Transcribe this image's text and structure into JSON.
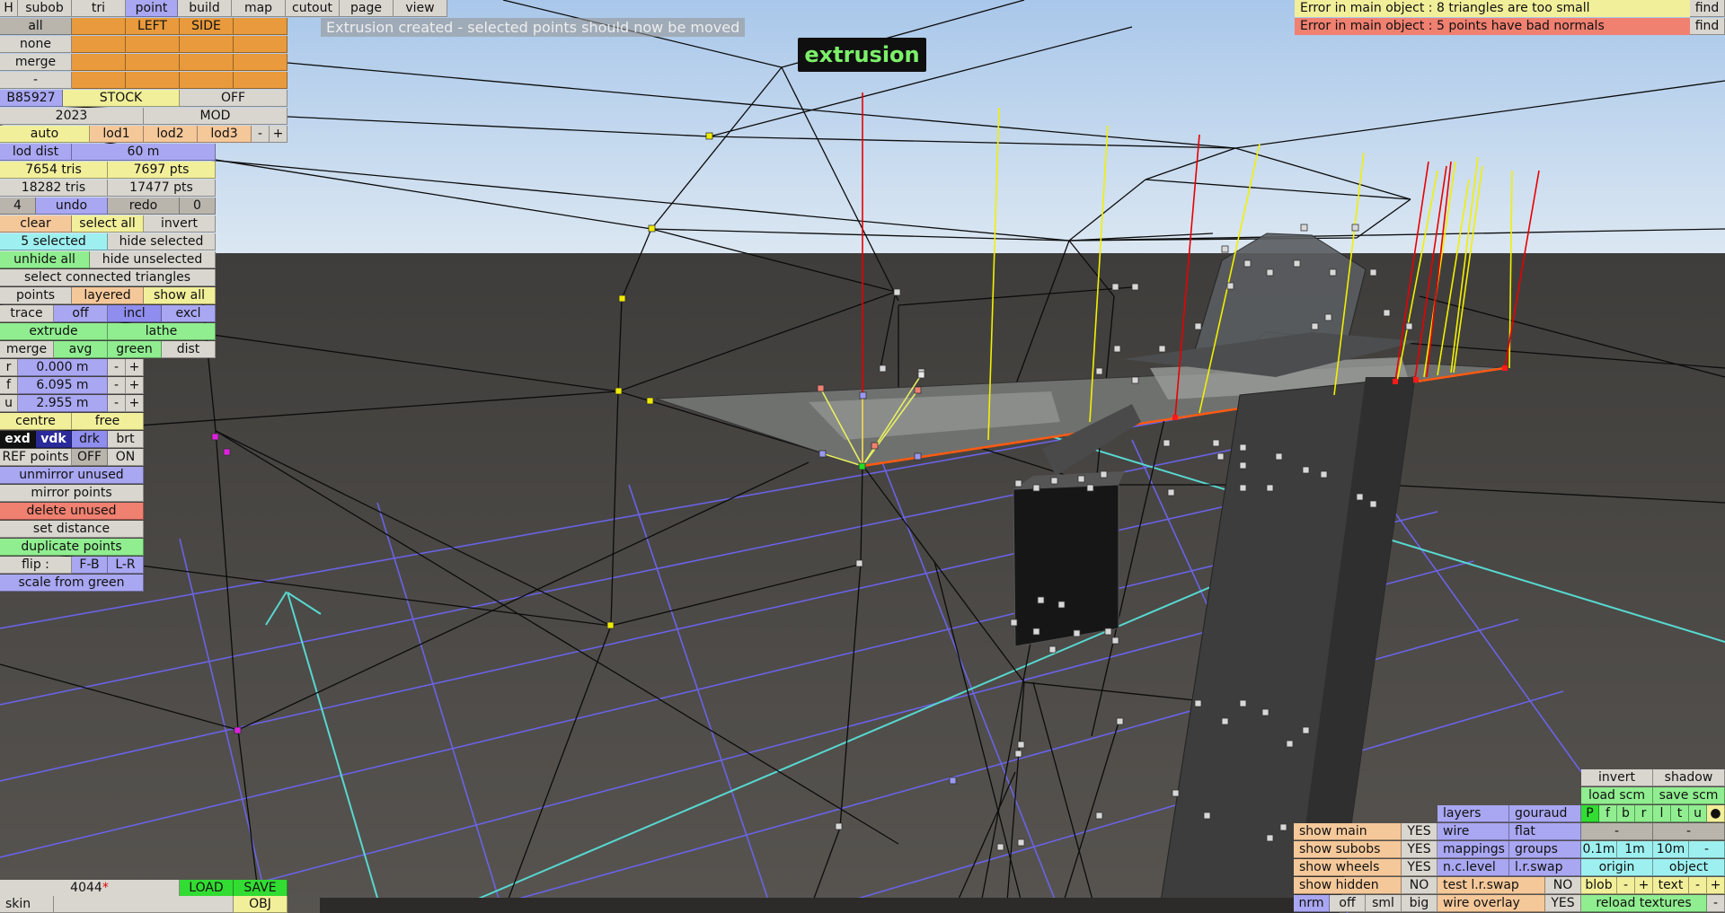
{
  "menu": {
    "h": "H",
    "subob": "subob",
    "tri": "tri",
    "point": "point",
    "build": "build",
    "map": "map",
    "cutout": "cutout",
    "page": "page",
    "view": "view"
  },
  "status_message": "Extrusion created - selected points should now be moved",
  "mode_badge": "extrusion",
  "errors": [
    {
      "text": "Error in main object : 8 triangles are too small",
      "find": "find"
    },
    {
      "text": "Error in main object : 5 points have bad normals",
      "find": "find"
    }
  ],
  "left": {
    "all": "all",
    "none": "none",
    "merge": "merge",
    "dash": "-",
    "left": "LEFT",
    "side": "SIDE",
    "code": "B85927",
    "stock": "STOCK",
    "off": "OFF",
    "year": "2023",
    "mod": "MOD",
    "auto": "auto",
    "lod1": "lod1",
    "lod2": "lod2",
    "lod3": "lod3",
    "minus": "-",
    "plus": "+",
    "lod_dist_label": "lod dist",
    "lod_dist_value": "60 m",
    "tris1": "7654 tris",
    "pts1": "7697 pts",
    "tris2": "18282 tris",
    "pts2": "17477 pts",
    "undo_count": "4",
    "undo": "undo",
    "redo": "redo",
    "redo_count": "0",
    "clear": "clear",
    "select_all": "select all",
    "invert": "invert",
    "selected": "5 selected",
    "hide_selected": "hide selected",
    "unhide_all": "unhide all",
    "hide_unselected": "hide unselected",
    "select_connected": "select connected triangles",
    "points": "points",
    "layered": "layered",
    "show_all": "show all",
    "trace": "trace",
    "trace_off": "off",
    "incl": "incl",
    "excl": "excl",
    "extrude": "extrude",
    "lathe": "lathe",
    "merge2": "merge",
    "avg": "avg",
    "green": "green",
    "dist": "dist",
    "r_label": "r",
    "r_value": "0.000 m",
    "f_label": "f",
    "f_value": "6.095 m",
    "u_label": "u",
    "u_value": "2.955 m",
    "centre": "centre",
    "free": "free",
    "exd": "exd",
    "vdk": "vdk",
    "drk": "drk",
    "brt": "brt",
    "ref_points": "REF points",
    "ref_off": "OFF",
    "ref_on": "ON",
    "unmirror": "unmirror unused",
    "mirror": "mirror points",
    "delete_unused": "delete unused",
    "set_distance": "set distance",
    "duplicate": "duplicate points",
    "flip": "flip :",
    "fb": "F-B",
    "lr": "L-R",
    "scale_green": "scale from green"
  },
  "bottom_left": {
    "counter": "4044",
    "counter_mark": "*",
    "load": "LOAD",
    "save": "SAVE",
    "skin": "skin",
    "obj": "OBJ"
  },
  "bottom_right": {
    "invert": "invert",
    "shadow": "shadow",
    "load_scm": "load scm",
    "save_scm": "save scm",
    "toggles": [
      "P",
      "f",
      "b",
      "r",
      "l",
      "t",
      "u",
      "●"
    ],
    "layers": "layers",
    "gouraud": "gouraud",
    "wire": "wire",
    "flat": "flat",
    "mappings": "mappings",
    "groups": "groups",
    "n_c_level": "n.c.level",
    "l_r_swap": "l.r.swap",
    "test_lr_swap": "test l.r.swap",
    "test_no": "NO",
    "wire_overlay": "wire overlay",
    "wire_yes": "YES",
    "dash": "-",
    "s01": "0.1m",
    "s1": "1m",
    "s10": "10m",
    "origin": "origin",
    "object": "object",
    "blob": "blob",
    "minus": "-",
    "plus": "+",
    "text": "text",
    "reload": "reload textures",
    "show_main": "show main",
    "show_subobs": "show subobs",
    "show_wheels": "show wheels",
    "show_hidden": "show hidden",
    "yes": "YES",
    "no": "NO",
    "nrm": "nrm",
    "off": "off",
    "sml": "sml",
    "big": "big"
  },
  "colors": {
    "sky": "#bfd6ee",
    "ground": "#4a4845",
    "grid": "#6a63e6",
    "axis": "#58d8d0",
    "accent": "#e89a3c"
  }
}
